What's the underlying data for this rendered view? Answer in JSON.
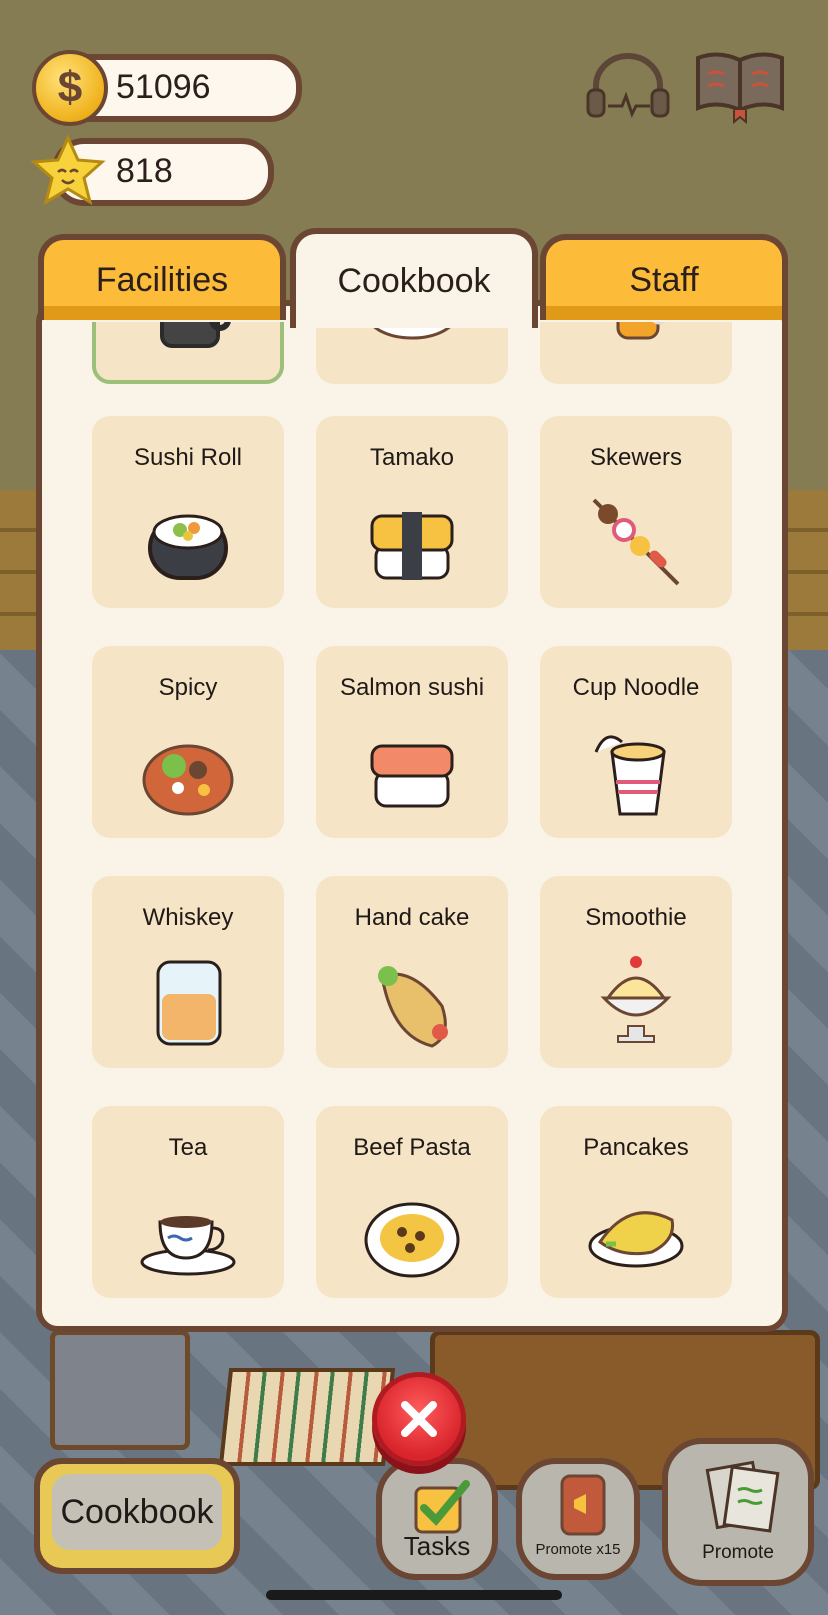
{
  "hud": {
    "coins": "51096",
    "stars": "818",
    "coin_icon": "dollar-coin-icon",
    "star_icon": "smiling-star-icon"
  },
  "tabs": [
    {
      "label": "Facilities",
      "active": false
    },
    {
      "label": "Cookbook",
      "active": true
    },
    {
      "label": "Staff",
      "active": false
    }
  ],
  "recipes": [
    {
      "name": "Sushi Roll",
      "icon": "sushi-roll-icon"
    },
    {
      "name": "Tamako",
      "icon": "tamago-sushi-icon"
    },
    {
      "name": "Skewers",
      "icon": "skewer-icon"
    },
    {
      "name": "Spicy",
      "icon": "spicy-bowl-icon"
    },
    {
      "name": "Salmon sushi",
      "icon": "salmon-sushi-icon"
    },
    {
      "name": "Cup Noodle",
      "icon": "cup-noodle-icon"
    },
    {
      "name": "Whiskey",
      "icon": "whiskey-glass-icon"
    },
    {
      "name": "Hand cake",
      "icon": "wrap-icon"
    },
    {
      "name": "Smoothie",
      "icon": "sundae-icon"
    },
    {
      "name": "Tea",
      "icon": "teacup-icon"
    },
    {
      "name": "Beef Pasta",
      "icon": "pasta-plate-icon"
    },
    {
      "name": "Pancakes",
      "icon": "omelette-icon"
    }
  ],
  "bottom_bar": {
    "cookbook_label": "Cookbook",
    "tasks_label": "Tasks",
    "promote_x15_label": "Promote x15",
    "promote_label": "Promote"
  },
  "colors": {
    "tab_active": "#faf4e8",
    "tab_inactive": "#fdbb3a",
    "card_bg": "#f6e4c6",
    "outline": "#6b4632",
    "close_red": "#e23a3a"
  }
}
